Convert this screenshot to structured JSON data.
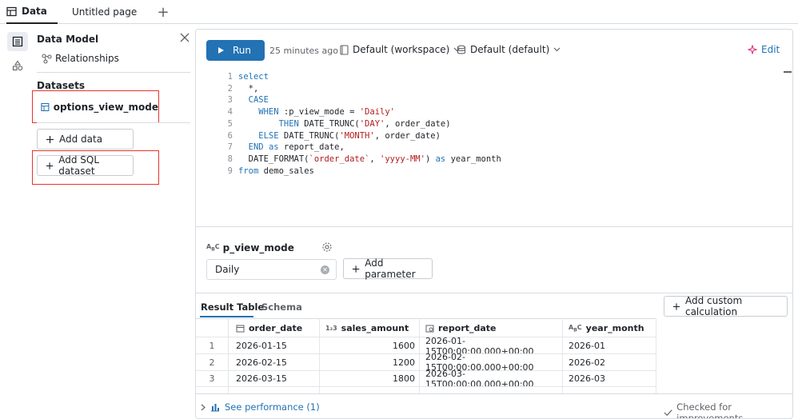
{
  "tabs": [
    {
      "label": "Data",
      "icon": "table-icon",
      "active": true
    },
    {
      "label": "Untitled page",
      "active": false
    }
  ],
  "sidebar": {
    "title": "Data Model",
    "relationships": "Relationships",
    "datasets_heading": "Datasets",
    "dataset_name": "options_view_mode",
    "add_data": "Add data",
    "add_sql_dataset": "Add SQL dataset"
  },
  "toolbar": {
    "run": "Run",
    "time": "25 minutes ago",
    "workspace": "Default (workspace)",
    "schema": "Default (default)",
    "edit": "Edit"
  },
  "editor": {
    "lines": [
      {
        "n": "1",
        "tokens": [
          {
            "t": "select",
            "c": "kw"
          }
        ]
      },
      {
        "n": "2",
        "tokens": [
          {
            "t": "  *,",
            "c": "var"
          }
        ]
      },
      {
        "n": "3",
        "tokens": [
          {
            "t": "  CASE",
            "c": "kw"
          }
        ]
      },
      {
        "n": "4",
        "tokens": [
          {
            "t": "    WHEN ",
            "c": "kw"
          },
          {
            "t": ":p_view_mode = ",
            "c": "var"
          },
          {
            "t": "'Daily'",
            "c": "str"
          }
        ]
      },
      {
        "n": "5",
        "tokens": [
          {
            "t": "        THEN ",
            "c": "kw"
          },
          {
            "t": "DATE_TRUNC(",
            "c": "var"
          },
          {
            "t": "'DAY'",
            "c": "str"
          },
          {
            "t": ", order_date)",
            "c": "var"
          }
        ]
      },
      {
        "n": "6",
        "tokens": [
          {
            "t": "    ELSE ",
            "c": "kw"
          },
          {
            "t": "DATE_TRUNC(",
            "c": "var"
          },
          {
            "t": "'MONTH'",
            "c": "str"
          },
          {
            "t": ", order_date)",
            "c": "var"
          }
        ]
      },
      {
        "n": "7",
        "tokens": [
          {
            "t": "  END ",
            "c": "kw"
          },
          {
            "t": "as",
            "c": "kw"
          },
          {
            "t": " report_date,",
            "c": "var"
          }
        ]
      },
      {
        "n": "8",
        "tokens": [
          {
            "t": "  DATE_FORMAT(",
            "c": "var"
          },
          {
            "t": "`order_date`",
            "c": "str"
          },
          {
            "t": ", ",
            "c": "var"
          },
          {
            "t": "'yyyy-MM'",
            "c": "str"
          },
          {
            "t": ") ",
            "c": "var"
          },
          {
            "t": "as",
            "c": "kw"
          },
          {
            "t": " year_month",
            "c": "var"
          }
        ]
      },
      {
        "n": "9",
        "tokens": [
          {
            "t": "from",
            "c": "kw"
          },
          {
            "t": " demo_sales",
            "c": "var"
          }
        ]
      }
    ]
  },
  "parameter": {
    "name": "p_view_mode",
    "value": "Daily",
    "add_parameter": "Add parameter"
  },
  "results": {
    "tab_result": "Result Table",
    "tab_schema": "Schema",
    "add_custom_calc": "Add custom calculation",
    "columns": [
      {
        "name": "order_date",
        "icon": "date-type-icon"
      },
      {
        "name": "sales_amount",
        "icon": "number-type-icon"
      },
      {
        "name": "report_date",
        "icon": "timestamp-type-icon"
      },
      {
        "name": "year_month",
        "icon": "string-type-icon"
      }
    ],
    "rows": [
      {
        "idx": "1",
        "order_date": "2026-01-15",
        "sales_amount": "1600",
        "report_date": "2026-01-15T00:00:00.000+00:00",
        "year_month": "2026-01"
      },
      {
        "idx": "2",
        "order_date": "2026-02-15",
        "sales_amount": "1200",
        "report_date": "2026-02-15T00:00:00.000+00:00",
        "year_month": "2026-02"
      },
      {
        "idx": "3",
        "order_date": "2026-03-15",
        "sales_amount": "1800",
        "report_date": "2026-03-15T00:00:00.000+00:00",
        "year_month": "2026-03"
      }
    ],
    "see_performance": "See performance (1)",
    "checked": "Checked for improvements"
  }
}
